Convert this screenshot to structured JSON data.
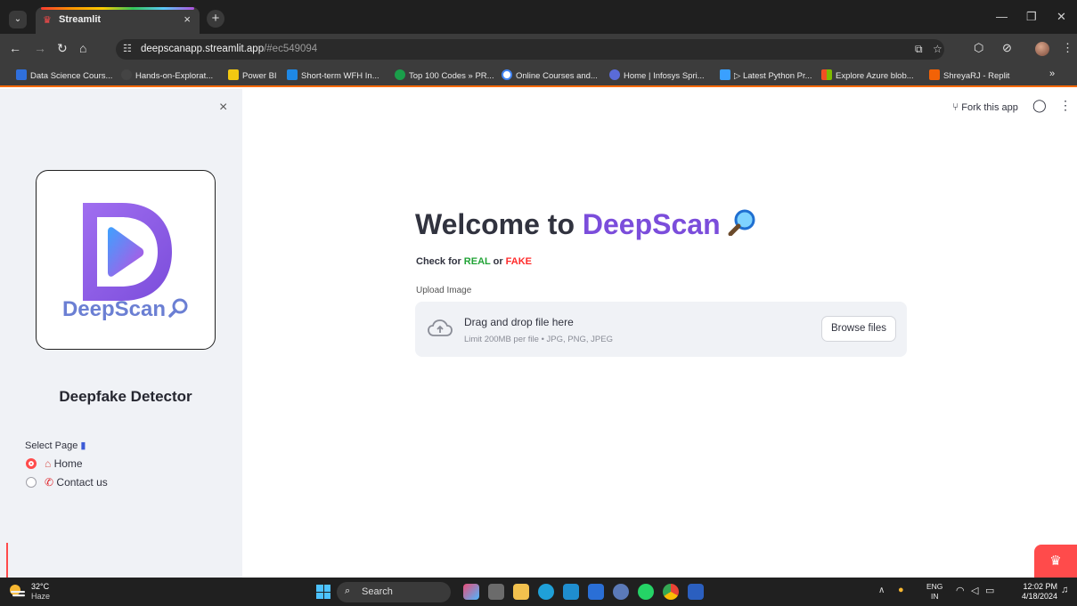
{
  "browser": {
    "tab_title": "Streamlit",
    "url_host": "deepscanapp.streamlit.app",
    "url_path": "/#ec549094",
    "bookmarks": [
      {
        "label": "Data Science Cours...",
        "icon": "ist-icon",
        "color": "#2f6fdc"
      },
      {
        "label": "Hands-on-Explorat...",
        "icon": "github-icon",
        "color": "#444444"
      },
      {
        "label": "Power BI",
        "icon": "powerbi-icon",
        "color": "#f2c811"
      },
      {
        "label": "Short-term WFH In...",
        "icon": "is-icon",
        "color": "#1e88e5"
      },
      {
        "label": "Top 100 Codes » PR...",
        "icon": "green-circle-icon",
        "color": "#1a9e4a"
      },
      {
        "label": "Online Courses and...",
        "icon": "google-icon",
        "color": "#ffffff"
      },
      {
        "label": "Home | Infosys Spri...",
        "icon": "infosys-icon",
        "color": "#5a6bd8"
      },
      {
        "label": "▷ Latest Python Pr...",
        "icon": "python-icon",
        "color": "#3aa0ff"
      },
      {
        "label": "Explore Azure blob...",
        "icon": "microsoft-icon",
        "color": "#f25022"
      },
      {
        "label": "ShreyaRJ - Replit",
        "icon": "replit-icon",
        "color": "#f26207"
      }
    ],
    "bookmarks_overflow": "»"
  },
  "sidebar": {
    "close": "×",
    "logo_text": "DeepScan",
    "heading": "Deepfake Detector",
    "select_label": "Select Page",
    "options": [
      {
        "label": "Home",
        "selected": true
      },
      {
        "label": "Contact us",
        "selected": false
      }
    ]
  },
  "header": {
    "fork_label": "Fork this app"
  },
  "main": {
    "title_prefix": "Welcome to ",
    "title_brand": "DeepScan",
    "check_prefix": "Check for ",
    "check_real": "REAL",
    "check_or": " or ",
    "check_fake": "FAKE",
    "upload_label": "Upload Image",
    "drop_title": "Drag and drop file here",
    "drop_limit": "Limit 200MB per file • JPG, PNG, JPEG",
    "browse_label": "Browse files"
  },
  "taskbar": {
    "weather_temp": "32°C",
    "weather_cond": "Haze",
    "search_placeholder": "Search",
    "lang_line1": "ENG",
    "lang_line2": "IN",
    "time": "12:02 PM",
    "date": "4/18/2024"
  },
  "colors": {
    "accent": "#ff4b4b",
    "brand_purple": "#7b4ddb",
    "real_green": "#21a336",
    "fake_red": "#ff2b2b",
    "sidebar_bg": "#f0f2f6"
  }
}
